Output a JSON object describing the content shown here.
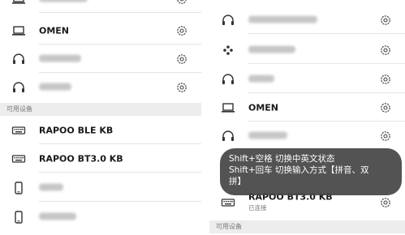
{
  "left_panel": {
    "devices_top": [
      {
        "icon": "laptop-icon",
        "name": "",
        "obscured": true
      },
      {
        "icon": "laptop-icon",
        "name": "OMEN"
      },
      {
        "icon": "headphones-icon",
        "name": "",
        "obscured": true
      },
      {
        "icon": "headphones-icon",
        "name": "",
        "obscured": true
      }
    ],
    "section_label": "可用设备",
    "available": [
      {
        "icon": "keyboard-icon",
        "name": "RAPOO BLE KB"
      },
      {
        "icon": "keyboard-icon",
        "name": "RAPOO BT3.0 KB"
      },
      {
        "icon": "phone-icon",
        "name": "",
        "obscured": true
      },
      {
        "icon": "phone-icon",
        "name": "",
        "obscured": true
      }
    ]
  },
  "right_panel": {
    "devices": [
      {
        "icon": "headphones-icon",
        "name": "",
        "obscured": true
      },
      {
        "icon": "gamepad-icon",
        "name": "",
        "obscured": true
      },
      {
        "icon": "headphones-icon",
        "name": "",
        "obscured": true
      },
      {
        "icon": "laptop-icon",
        "name": "OMEN"
      },
      {
        "icon": "headphones-icon",
        "name": "",
        "obscured": true
      },
      {
        "icon": "keyboard-icon",
        "name": "RAPOO BT3.0 KB",
        "status": "已连接"
      }
    ],
    "section_label": "可用设备"
  },
  "toast": {
    "line1": "Shift+空格 切换中英文状态",
    "line2": "Shift+回车 切换输入方式【拼音、双",
    "line3": "拼】"
  },
  "colors": {
    "background": "#ffffff",
    "section_bg": "#ededed",
    "divider": "#e4e4e4",
    "toast_bg": "#464646"
  }
}
